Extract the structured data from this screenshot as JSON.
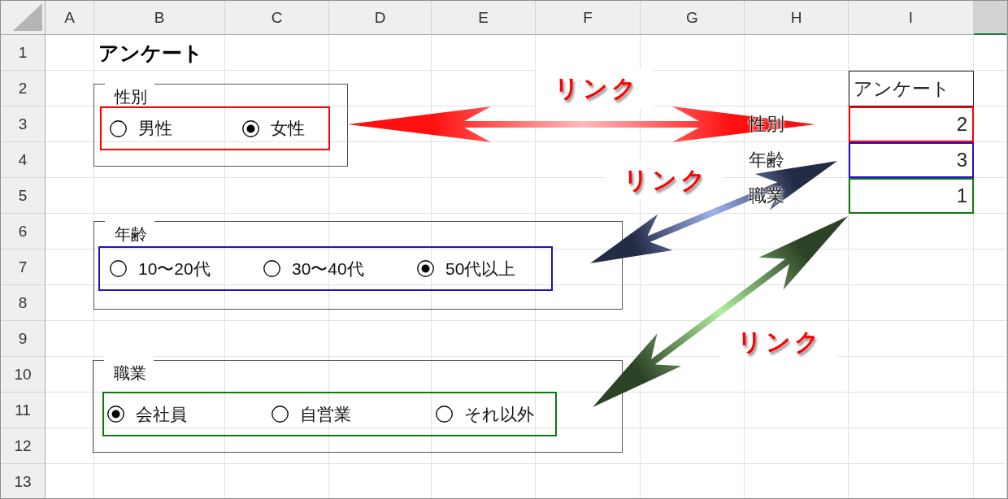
{
  "sheet": {
    "columns": [
      {
        "label": "A",
        "selected": false
      },
      {
        "label": "B",
        "selected": false
      },
      {
        "label": "C",
        "selected": false
      },
      {
        "label": "D",
        "selected": false
      },
      {
        "label": "E",
        "selected": false
      },
      {
        "label": "F",
        "selected": false
      },
      {
        "label": "G",
        "selected": false
      },
      {
        "label": "H",
        "selected": false
      },
      {
        "label": "I",
        "selected": false
      },
      {
        "selected": true
      }
    ],
    "rows": [
      "1",
      "2",
      "3",
      "4",
      "5",
      "6",
      "7",
      "8",
      "9",
      "10",
      "11",
      "12",
      "13"
    ]
  },
  "title": "アンケート",
  "groups": [
    {
      "label": "性別",
      "color": "#ff0000",
      "options": [
        {
          "label": "男性",
          "selected": false
        },
        {
          "label": "女性",
          "selected": true
        }
      ]
    },
    {
      "label": "年齢",
      "color": "#2010c8",
      "options": [
        {
          "label": "10〜20代",
          "selected": false
        },
        {
          "label": "30〜40代",
          "selected": false
        },
        {
          "label": "50代以上",
          "selected": true
        }
      ]
    },
    {
      "label": "職業",
      "color": "#0a7d0a",
      "options": [
        {
          "label": "会社員",
          "selected": true
        },
        {
          "label": "自営業",
          "selected": false
        },
        {
          "label": "それ以外",
          "selected": false
        }
      ]
    }
  ],
  "linked_cells": {
    "header": "アンケート",
    "rows": [
      {
        "label": "性別",
        "value": "2",
        "color": "#ff0000"
      },
      {
        "label": "年齢",
        "value": "3",
        "color": "#2010c8"
      },
      {
        "label": "職業",
        "value": "1",
        "color": "#0a7d0a"
      }
    ]
  },
  "links": [
    {
      "label": "リンク",
      "color": "#ff1010"
    },
    {
      "label": "リンク",
      "color": "#232c45"
    },
    {
      "label": "リンク",
      "color": "#2c4225"
    }
  ]
}
